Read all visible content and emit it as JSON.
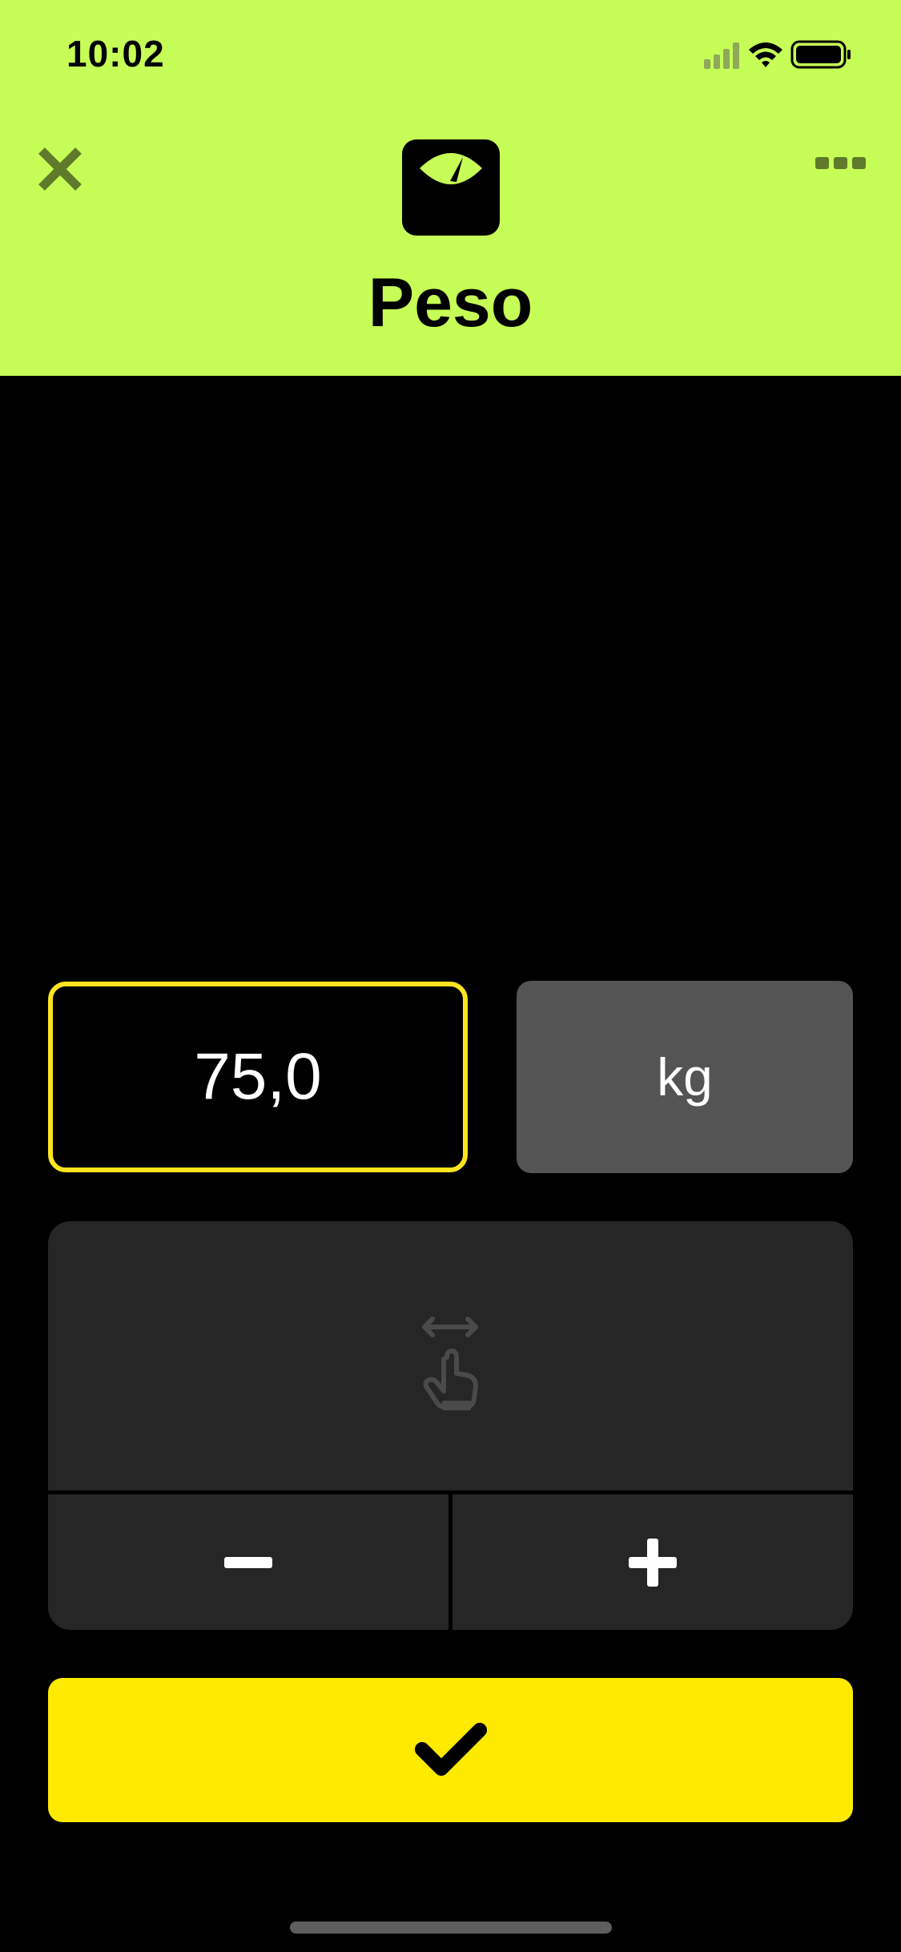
{
  "status_bar": {
    "time": "10:02",
    "icons": [
      "cellular-signal-icon",
      "wifi-icon",
      "battery-icon"
    ]
  },
  "header": {
    "title": "Peso",
    "icon": "scale-icon",
    "close_icon": "close-icon",
    "more_icon": "more-icon",
    "background_color": "#c6fd56"
  },
  "measurement": {
    "value": "75,0",
    "unit": "kg"
  },
  "adjuster": {
    "gesture_icon": "swipe-horizontal-icon",
    "minus_icon": "minus-icon",
    "plus_icon": "plus-icon"
  },
  "confirm": {
    "icon": "checkmark-icon",
    "color": "#ffea00"
  },
  "colors": {
    "active_border": "#fde41e",
    "panel": "#262626",
    "unit_button": "#545454"
  }
}
